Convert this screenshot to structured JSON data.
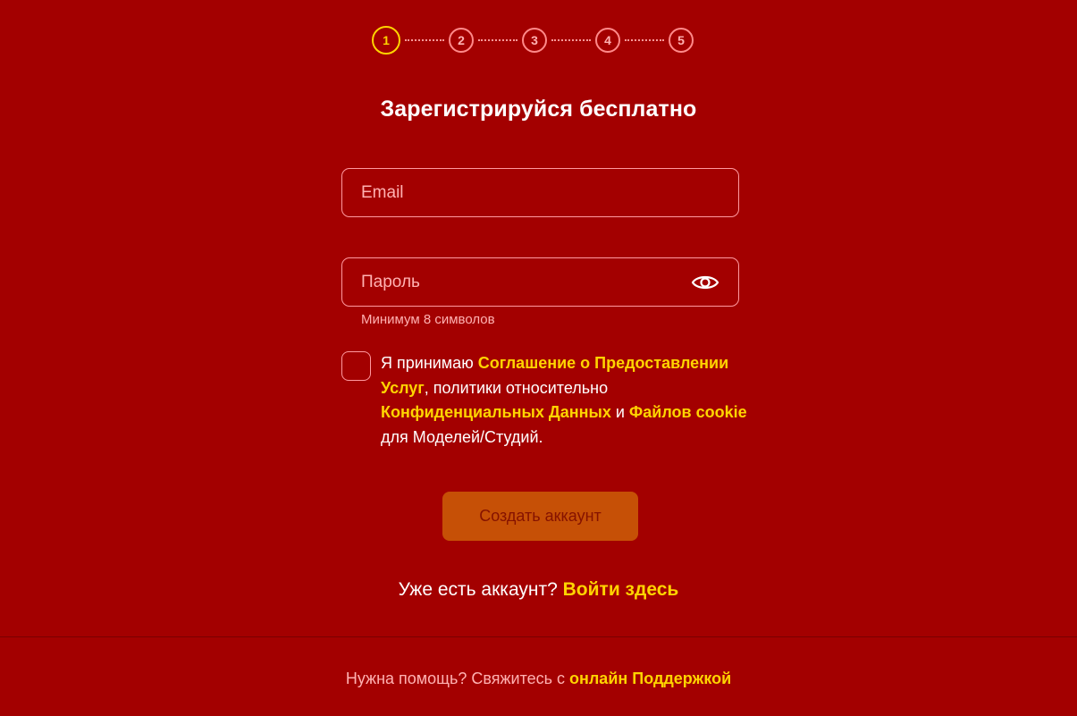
{
  "stepper": {
    "current_step": 1,
    "steps": [
      "1",
      "2",
      "3",
      "4",
      "5"
    ]
  },
  "title": "Зарегистрируйся бесплатно",
  "email": {
    "placeholder": "Email",
    "value": ""
  },
  "password": {
    "placeholder": "Пароль",
    "value": "",
    "hint": "Минимум 8 символов",
    "toggle_icon": "eye-icon"
  },
  "terms": {
    "checked": false,
    "prefix": "Я принимаю ",
    "link_agreement": "Соглашение о Предоставлении Услуг",
    "middle": ", политики относительно ",
    "link_privacy": "Конфиденциальных Данных",
    "and": " и ",
    "link_cookies": "Файлов cookie",
    "suffix": " для Моделей/Студий."
  },
  "create_button": {
    "label": "Создать аккаунт"
  },
  "login": {
    "prompt": "Уже есть аккаунт? ",
    "link": "Войти здесь"
  },
  "footer": {
    "text": "Нужна помощь? Свяжитесь с ",
    "link": "онлайн Поддержкой"
  },
  "colors": {
    "background": "#a30000",
    "accent": "#ffd400",
    "button": "#c65006",
    "muted_text": "#ffb2b2"
  }
}
